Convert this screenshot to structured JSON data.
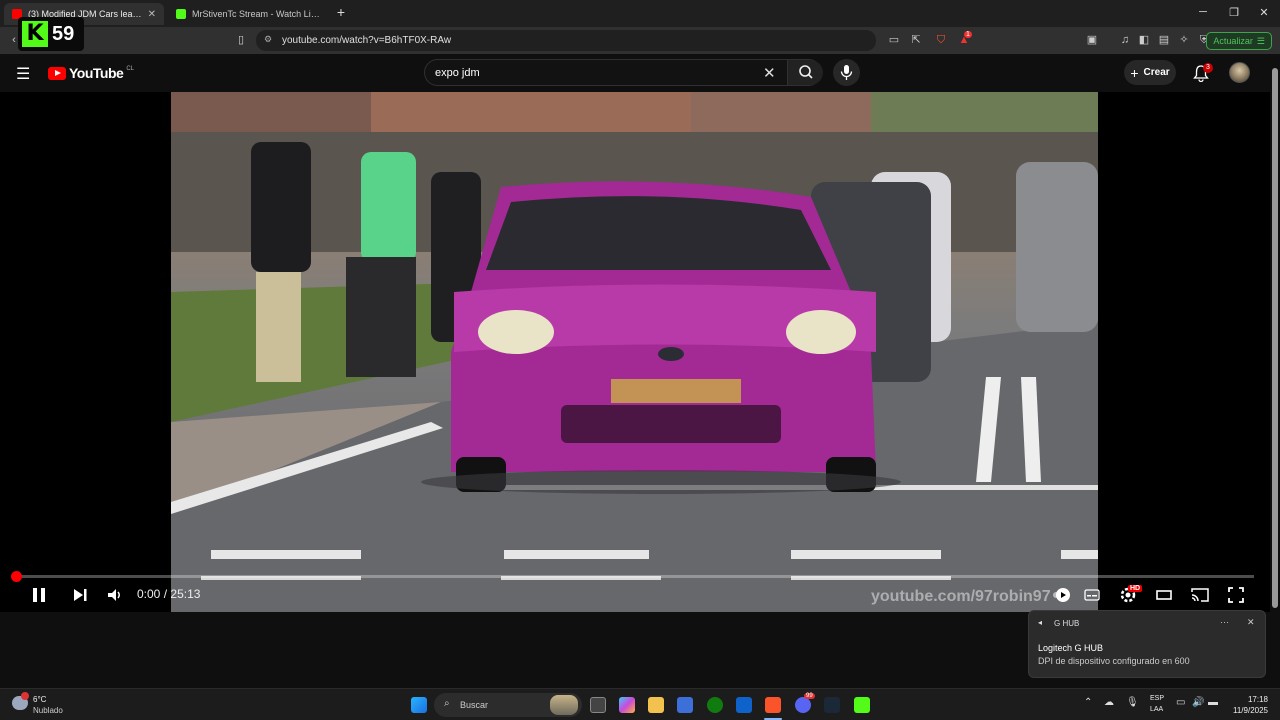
{
  "browser": {
    "tabs": [
      {
        "title": "(3) Modified JDM Cars leaving",
        "active": true
      },
      {
        "title": "MrStivenTc Stream - Watch Live on K",
        "active": false
      }
    ],
    "url": "youtube.com/watch?v=B6hTF0X-RAw",
    "shield_badge": "1",
    "update_label": "Actualizar",
    "window_controls": [
      "minimize-icon",
      "restore-icon",
      "close-icon"
    ]
  },
  "overlay": {
    "kick_label": "K",
    "viewer_count": "59"
  },
  "youtube": {
    "logo_word": "YouTube",
    "country_code": "CL",
    "search_query": "expo jdm",
    "create_label": "Crear",
    "notification_count": "3"
  },
  "player": {
    "current_time": "0:00",
    "separator": "/",
    "duration": "25:13",
    "progress": 0.0,
    "watermark": "youtube.com/97robin97",
    "quality_badge": "HD"
  },
  "toast": {
    "app": "G HUB",
    "title": "Logitech G HUB",
    "message": "DPI de dispositivo configurado en 600"
  },
  "taskbar": {
    "weather_temp": "6°C",
    "weather_desc": "Nublado",
    "search_placeholder": "Buscar",
    "lang_top": "ESP",
    "lang_bottom": "LAA",
    "time": "17:18",
    "date": "11/9/2025",
    "discord_badge": "99"
  },
  "colors": {
    "accent_red": "#ff0000",
    "kick_green": "#53fc18",
    "update_green": "#4fc35f"
  }
}
